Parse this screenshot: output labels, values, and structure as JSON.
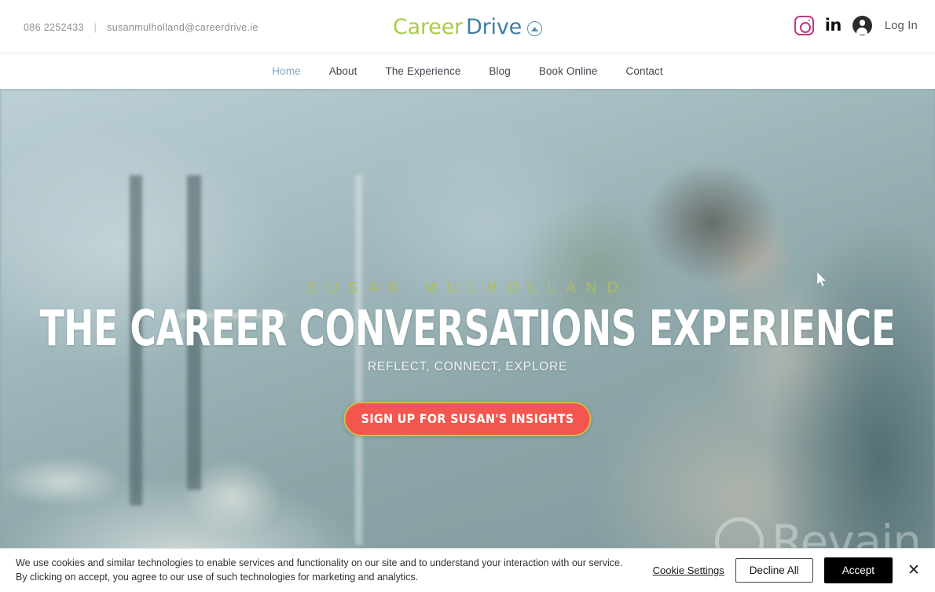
{
  "topbar": {
    "phone": "086 2252433",
    "separator": "|",
    "email": "susanmulholland@careerdrive.ie",
    "brand": {
      "part1": "Career",
      "part2": "Drive",
      "part1_color": "#a8cc4a",
      "part2_color": "#3d7fa6"
    },
    "actions": {
      "instagram_label": "Instagram",
      "linkedin_label": "in",
      "login_label": "Log In"
    }
  },
  "nav": {
    "items": [
      {
        "label": "Home",
        "active": true
      },
      {
        "label": "About",
        "active": false
      },
      {
        "label": "The Experience",
        "active": false
      },
      {
        "label": "Blog",
        "active": false
      },
      {
        "label": "Book Online",
        "active": false
      },
      {
        "label": "Contact",
        "active": false
      }
    ],
    "active_color": "#7fa8c4"
  },
  "hero": {
    "eyebrow": "SUSAN MULHOLLAND",
    "eyebrow_color": "#b0be5a",
    "title": "THE CAREER CONVERSATIONS EXPERIENCE",
    "subtitle": "REFLECT, CONNECT, EXPLORE",
    "cta_label": "SIGN UP FOR SUSAN'S INSIGHTS",
    "cta_bg": "#f2564e",
    "cta_border": "#c9c24a"
  },
  "watermark": {
    "text": "Revain"
  },
  "cookie_banner": {
    "line1": "We use cookies and similar technologies to enable services and functionality on our site and to understand your interaction with our service.",
    "line2": "By clicking on accept, you agree to our use of such technologies for marketing and analytics.",
    "settings_label": "Cookie Settings",
    "decline_label": "Decline All",
    "accept_label": "Accept",
    "close_label": "✕"
  }
}
